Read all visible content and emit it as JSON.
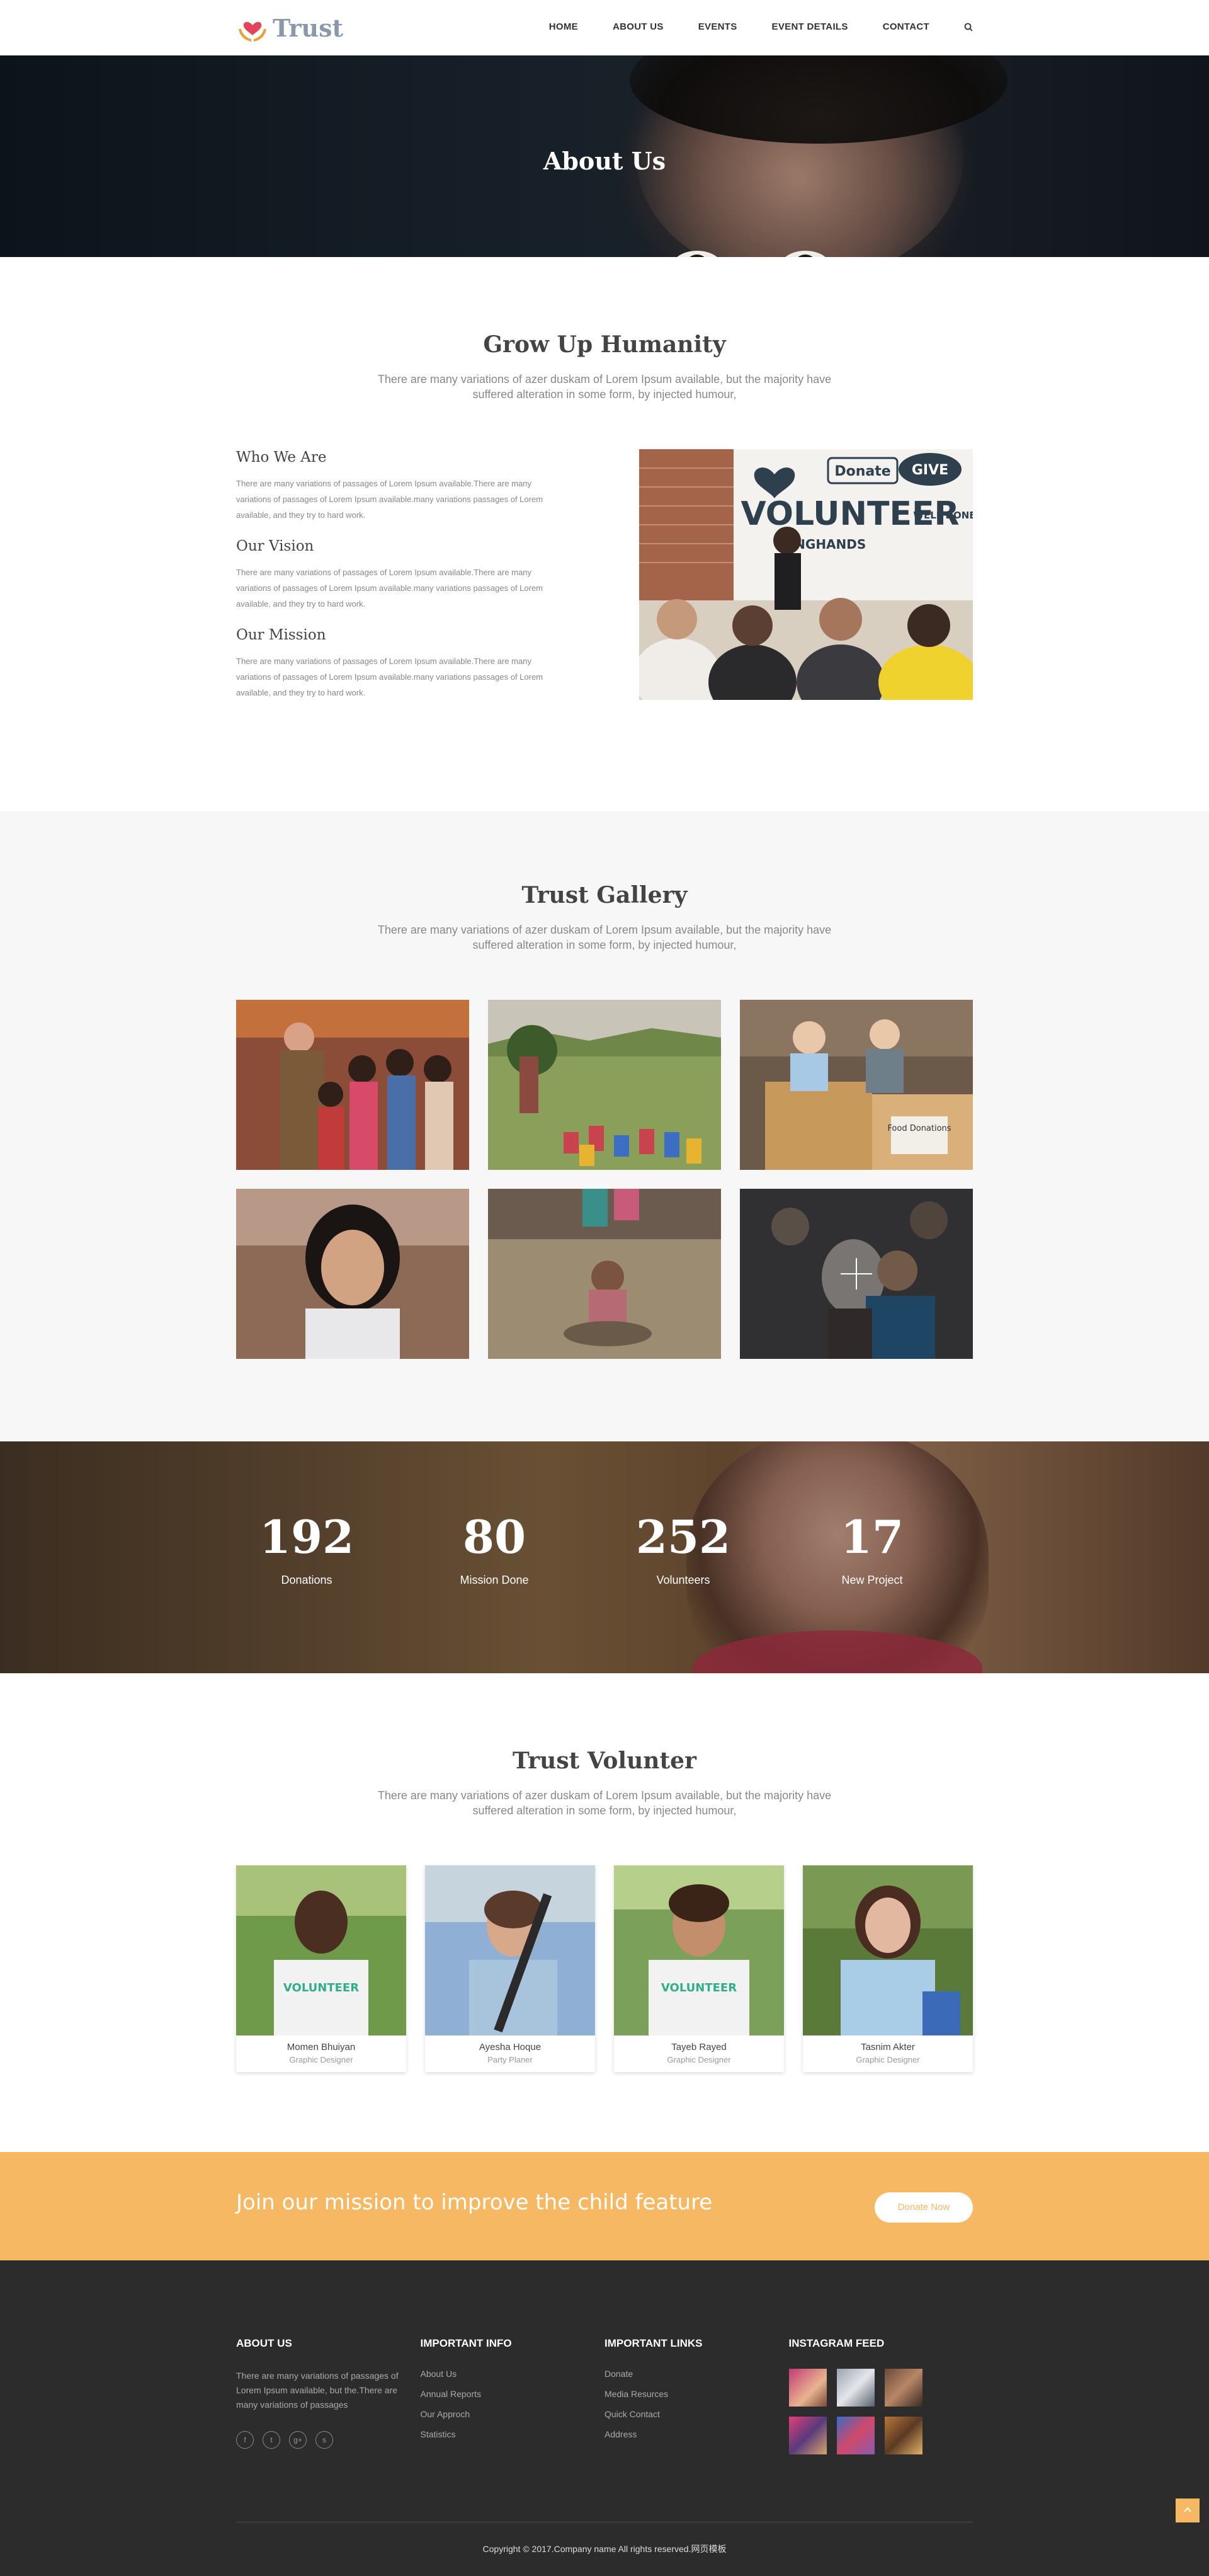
{
  "brand": {
    "name": "Trust"
  },
  "nav": {
    "items": [
      "HOME",
      "ABOUT US",
      "EVENTS",
      "EVENT DETAILS",
      "CONTACT"
    ]
  },
  "hero": {
    "title": "About Us"
  },
  "about": {
    "title": "Grow Up Humanity",
    "subtitle": "There are many variations of azer duskam of Lorem Ipsum available, but the majority have suffered alteration in some form, by injected humour,",
    "blocks": [
      {
        "heading": "Who We Are",
        "text": "There are many variations of passages of Lorem Ipsum available.There are many variations of passages of Lorem Ipsum available.many variations passages of Lorem available, and they try to hard work."
      },
      {
        "heading": "Our Vision",
        "text": "There are many variations of passages of Lorem Ipsum available.There are many variations of passages of Lorem Ipsum available.many variations passages of Lorem available, and they try to hard work."
      },
      {
        "heading": "Our Mission",
        "text": "There are many variations of passages of Lorem Ipsum available.There are many variations of passages of Lorem Ipsum available.many variations passages of Lorem available, and they try to hard work."
      }
    ],
    "image_words": {
      "volunteer": "VOLUNTEER",
      "donate": "Donate",
      "give": "GIVE",
      "well_done": "WELL DONE",
      "hands": "INGHANDS"
    }
  },
  "gallery": {
    "title": "Trust Gallery",
    "subtitle": "There are many variations of azer duskam of Lorem Ipsum available, but the majority have suffered alteration in some form, by injected humour,",
    "box_text": "Food Donations"
  },
  "counters": [
    {
      "value": "192",
      "label": "Donations"
    },
    {
      "value": "80",
      "label": "Mission Done"
    },
    {
      "value": "252",
      "label": "Volunteers"
    },
    {
      "value": "17",
      "label": "New Project"
    }
  ],
  "volunteers": {
    "title": "Trust Volunter",
    "subtitle": "There are many variations of azer duskam of Lorem Ipsum available, but the majority have suffered alteration in some form, by injected humour,",
    "shirt_text": "VOLUNTEER",
    "people": [
      {
        "name": "Momen Bhuiyan",
        "role": "Graphic Designer"
      },
      {
        "name": "Ayesha Hoque",
        "role": "Party Planer"
      },
      {
        "name": "Tayeb Rayed",
        "role": "Graphic Designer"
      },
      {
        "name": "Tasnim Akter",
        "role": "Graphic Designer"
      }
    ]
  },
  "cta": {
    "text": "Join our mission to improve the child feature",
    "button": "Donate Now"
  },
  "footer": {
    "about_title": "ABOUT US",
    "about_text": "There are many variations of passages of Lorem Ipsum available, but the.There are many variations of passages",
    "info_title": "IMPORTANT INFO",
    "info_links": [
      "About Us",
      "Annual Reports",
      "Our Approch",
      "Statistics"
    ],
    "links_title": "IMPORTANT LINKS",
    "links": [
      "Donate",
      "Media Resurces",
      "Quick Contact",
      "Address"
    ],
    "insta_title": "INSTAGRAM FEED",
    "copyright": "Copyright © 2017.Company name All rights reserved.网页模板"
  },
  "colors": {
    "accent": "#f7b863",
    "footer_bg": "#2c2c2c",
    "gallery_bg": "#f7f7f7",
    "logo_text": "#8a98ab"
  },
  "icons": {
    "search": "search-icon",
    "social": [
      "facebook-icon",
      "twitter-icon",
      "google-plus-icon",
      "skype-icon"
    ],
    "back_to_top": "chevron-up-icon"
  }
}
